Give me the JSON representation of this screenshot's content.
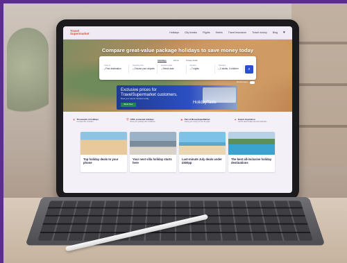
{
  "site": {
    "logo_line1": "Travel",
    "logo_line2": "Supermarket",
    "nav": [
      "Holidays",
      "City breaks",
      "Flights",
      "Hotels",
      "Travel insurance",
      "Travel money",
      "Blog"
    ]
  },
  "hero": {
    "title": "Compare great-value package holidays to save money today",
    "tabs": [
      "Holidays",
      "All-inc",
      "Cheap deals"
    ],
    "fields": [
      {
        "label": "Going to",
        "value": "Find destination"
      },
      {
        "label": "Departing from",
        "value": "Choose your airports"
      },
      {
        "label": "Departure date",
        "value": "Select date"
      },
      {
        "label": "Duration",
        "value": "7 nights"
      },
      {
        "label": "Travellers",
        "value": "2 adults, 0 children"
      }
    ],
    "flex_label": "Flexible dates"
  },
  "promo": {
    "headline": "Exclusive prices for TravelSupermarket customers.",
    "sub": "Book your airport transfers today",
    "button": "Book Now",
    "brand": "HolidayTaxis"
  },
  "features": [
    {
      "title": "Thousands of holidays",
      "sub": "Compare 50+ providers"
    },
    {
      "title": "ATOL protected holidays",
      "sub": "Book your getaway with confidence"
    },
    {
      "title": "Part of MoneySuperMarket",
      "sub": "Saving you money for over 20 years"
    },
    {
      "title": "Expert inspiration",
      "sub": "Get the latest holiday tips and inspiration"
    }
  ],
  "cards": [
    {
      "title": "Top holiday deals to your phone"
    },
    {
      "title": "Your next villa holiday starts here"
    },
    {
      "title": "Last-minute July deals under £500pp"
    },
    {
      "title": "The best all-inclusive holiday destinations"
    }
  ],
  "colors": {
    "brand": "#e2483b",
    "accent": "#2b4fce",
    "frame": "#5b2d8c"
  }
}
